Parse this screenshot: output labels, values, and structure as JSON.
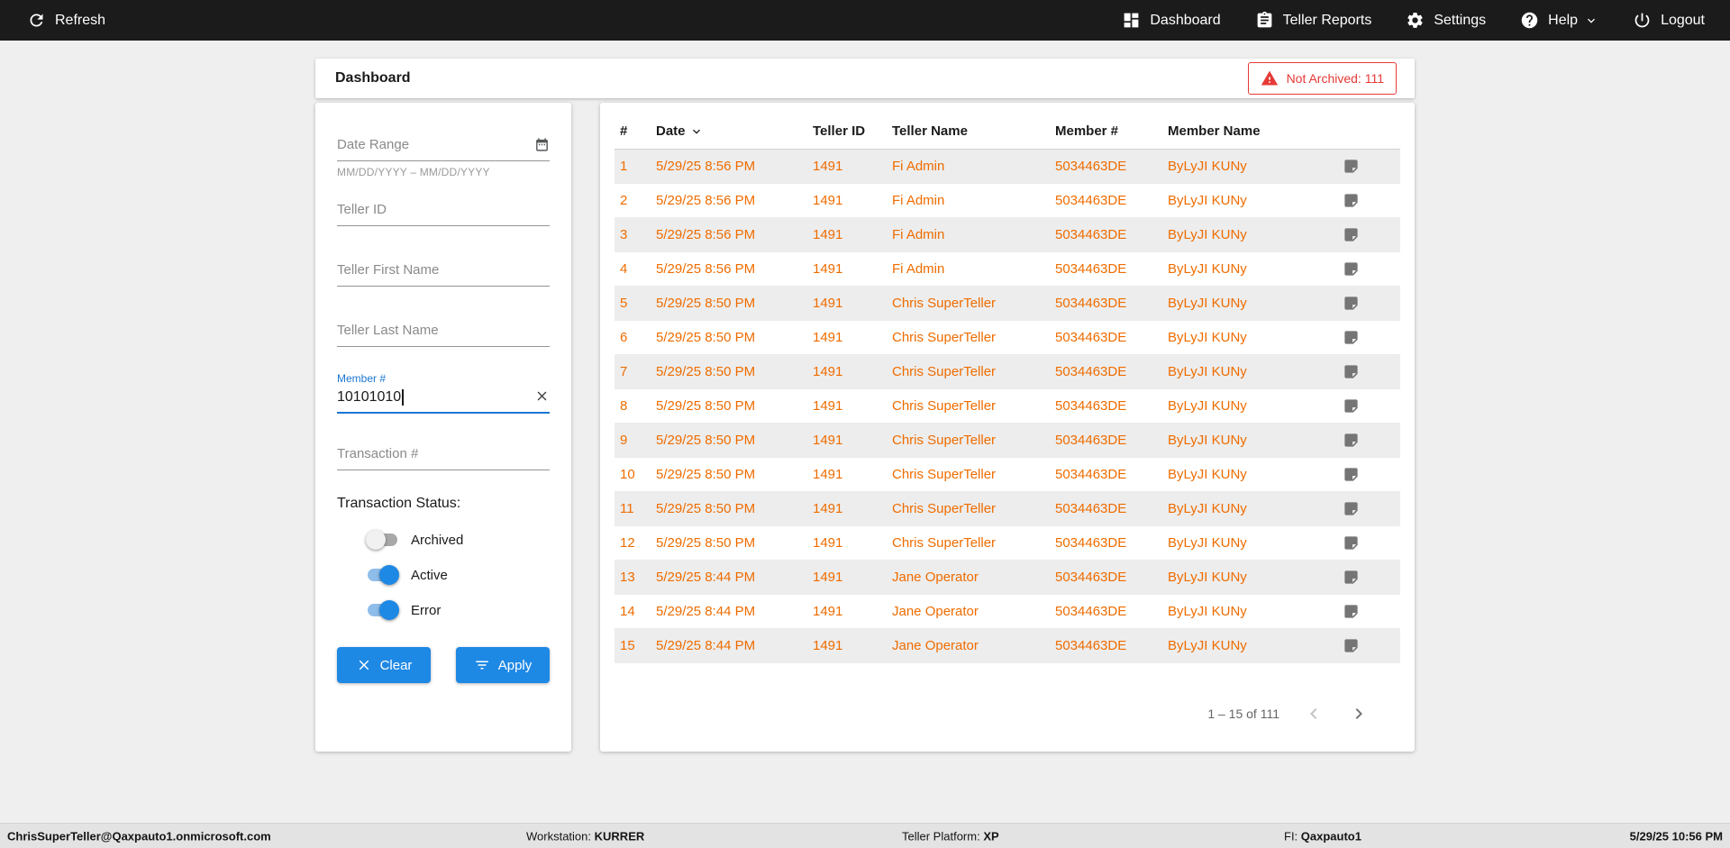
{
  "colors": {
    "accent_blue": "#1e88e5",
    "row_text_orange": "#ef6c00",
    "alert_red": "#e53935",
    "topbar_bg": "#1b1b1b"
  },
  "topbar": {
    "refresh_label": "Refresh",
    "dashboard_label": "Dashboard",
    "teller_reports_label": "Teller Reports",
    "settings_label": "Settings",
    "help_label": "Help",
    "logout_label": "Logout"
  },
  "page_header": {
    "title": "Dashboard",
    "not_archived_badge": "Not Archived: 111"
  },
  "filters": {
    "date_range_placeholder": "Date Range",
    "date_range_hint": "MM/DD/YYYY – MM/DD/YYYY",
    "teller_id_placeholder": "Teller ID",
    "teller_first_name_placeholder": "Teller First Name",
    "teller_last_name_placeholder": "Teller Last Name",
    "member_label": "Member #",
    "member_value": "10101010",
    "transaction_placeholder": "Transaction #",
    "status_heading": "Transaction Status:",
    "toggles": [
      {
        "label": "Archived",
        "on": false
      },
      {
        "label": "Active",
        "on": true
      },
      {
        "label": "Error",
        "on": true
      }
    ],
    "clear_button": "Clear",
    "apply_button": "Apply"
  },
  "table": {
    "columns": {
      "num": "#",
      "date": "Date",
      "teller_id": "Teller ID",
      "teller_name": "Teller Name",
      "member_num": "Member #",
      "member_name": "Member Name"
    },
    "rows": [
      {
        "num": "1",
        "date": "5/29/25 8:56 PM",
        "teller_id": "1491",
        "teller_name": "Fi Admin",
        "member_num": "5034463DE",
        "member_name": "ByLyJI KUNy"
      },
      {
        "num": "2",
        "date": "5/29/25 8:56 PM",
        "teller_id": "1491",
        "teller_name": "Fi Admin",
        "member_num": "5034463DE",
        "member_name": "ByLyJI KUNy"
      },
      {
        "num": "3",
        "date": "5/29/25 8:56 PM",
        "teller_id": "1491",
        "teller_name": "Fi Admin",
        "member_num": "5034463DE",
        "member_name": "ByLyJI KUNy"
      },
      {
        "num": "4",
        "date": "5/29/25 8:56 PM",
        "teller_id": "1491",
        "teller_name": "Fi Admin",
        "member_num": "5034463DE",
        "member_name": "ByLyJI KUNy"
      },
      {
        "num": "5",
        "date": "5/29/25 8:50 PM",
        "teller_id": "1491",
        "teller_name": "Chris SuperTeller",
        "member_num": "5034463DE",
        "member_name": "ByLyJI KUNy"
      },
      {
        "num": "6",
        "date": "5/29/25 8:50 PM",
        "teller_id": "1491",
        "teller_name": "Chris SuperTeller",
        "member_num": "5034463DE",
        "member_name": "ByLyJI KUNy"
      },
      {
        "num": "7",
        "date": "5/29/25 8:50 PM",
        "teller_id": "1491",
        "teller_name": "Chris SuperTeller",
        "member_num": "5034463DE",
        "member_name": "ByLyJI KUNy"
      },
      {
        "num": "8",
        "date": "5/29/25 8:50 PM",
        "teller_id": "1491",
        "teller_name": "Chris SuperTeller",
        "member_num": "5034463DE",
        "member_name": "ByLyJI KUNy"
      },
      {
        "num": "9",
        "date": "5/29/25 8:50 PM",
        "teller_id": "1491",
        "teller_name": "Chris SuperTeller",
        "member_num": "5034463DE",
        "member_name": "ByLyJI KUNy"
      },
      {
        "num": "10",
        "date": "5/29/25 8:50 PM",
        "teller_id": "1491",
        "teller_name": "Chris SuperTeller",
        "member_num": "5034463DE",
        "member_name": "ByLyJI KUNy"
      },
      {
        "num": "11",
        "date": "5/29/25 8:50 PM",
        "teller_id": "1491",
        "teller_name": "Chris SuperTeller",
        "member_num": "5034463DE",
        "member_name": "ByLyJI KUNy"
      },
      {
        "num": "12",
        "date": "5/29/25 8:50 PM",
        "teller_id": "1491",
        "teller_name": "Chris SuperTeller",
        "member_num": "5034463DE",
        "member_name": "ByLyJI KUNy"
      },
      {
        "num": "13",
        "date": "5/29/25 8:44 PM",
        "teller_id": "1491",
        "teller_name": "Jane Operator",
        "member_num": "5034463DE",
        "member_name": "ByLyJI KUNy"
      },
      {
        "num": "14",
        "date": "5/29/25 8:44 PM",
        "teller_id": "1491",
        "teller_name": "Jane Operator",
        "member_num": "5034463DE",
        "member_name": "ByLyJI KUNy"
      },
      {
        "num": "15",
        "date": "5/29/25 8:44 PM",
        "teller_id": "1491",
        "teller_name": "Jane Operator",
        "member_num": "5034463DE",
        "member_name": "ByLyJI KUNy"
      }
    ],
    "pagination": {
      "range_label": "1 – 15 of 111"
    }
  },
  "statusbar": {
    "user": "ChrisSuperTeller@Qaxpauto1.onmicrosoft.com",
    "workstation_label": "Workstation:",
    "workstation_value": "KURRER",
    "teller_platform_label": "Teller Platform:",
    "teller_platform_value": "XP",
    "fi_label": "FI:",
    "fi_value": "Qaxpauto1",
    "datetime": "5/29/25 10:56 PM"
  }
}
